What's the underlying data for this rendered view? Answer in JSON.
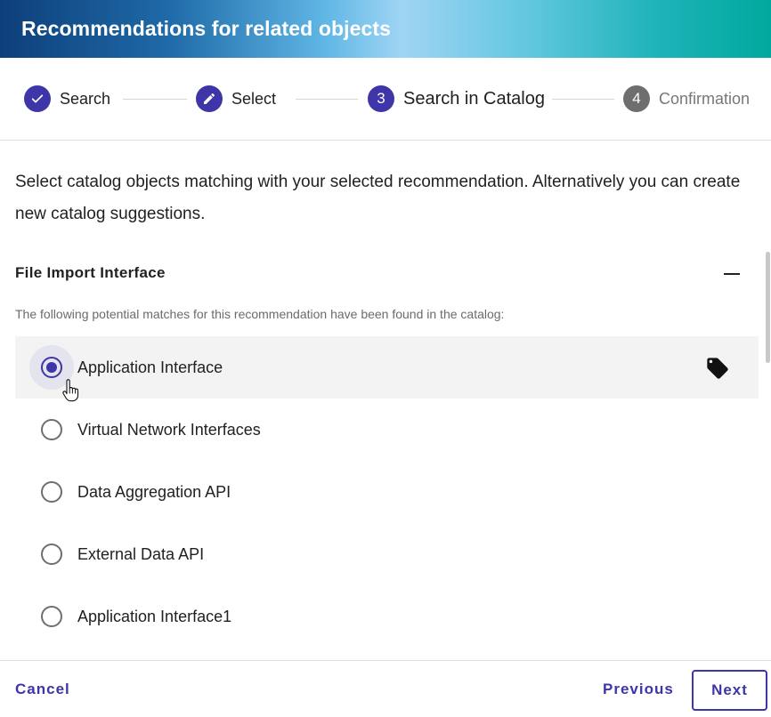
{
  "dialog": {
    "title": "Recommendations for related objects"
  },
  "stepper": {
    "steps": [
      {
        "label": "Search",
        "state": "completed",
        "icon": "check-icon"
      },
      {
        "label": "Select",
        "state": "completed",
        "icon": "pencil-icon"
      },
      {
        "number": "3",
        "label": "Search in Catalog",
        "state": "active"
      },
      {
        "number": "4",
        "label": "Confirmation",
        "state": "inactive"
      }
    ]
  },
  "content": {
    "intro": "Select catalog objects matching with your selected recommendation. Alternatively you can create new catalog suggestions.",
    "section_title": "File Import Interface",
    "hint": "The following potential matches for this recommendation have been found in the catalog:",
    "options": [
      {
        "label": "Application Interface",
        "selected": true
      },
      {
        "label": "Virtual Network Interfaces",
        "selected": false
      },
      {
        "label": "Data Aggregation API",
        "selected": false
      },
      {
        "label": "External Data API",
        "selected": false
      },
      {
        "label": "Application Interface1",
        "selected": false
      }
    ]
  },
  "footer": {
    "cancel": "Cancel",
    "previous": "Previous",
    "next": "Next"
  },
  "colors": {
    "accent": "#3d35a8",
    "inactive_step": "#6e6e6e"
  }
}
